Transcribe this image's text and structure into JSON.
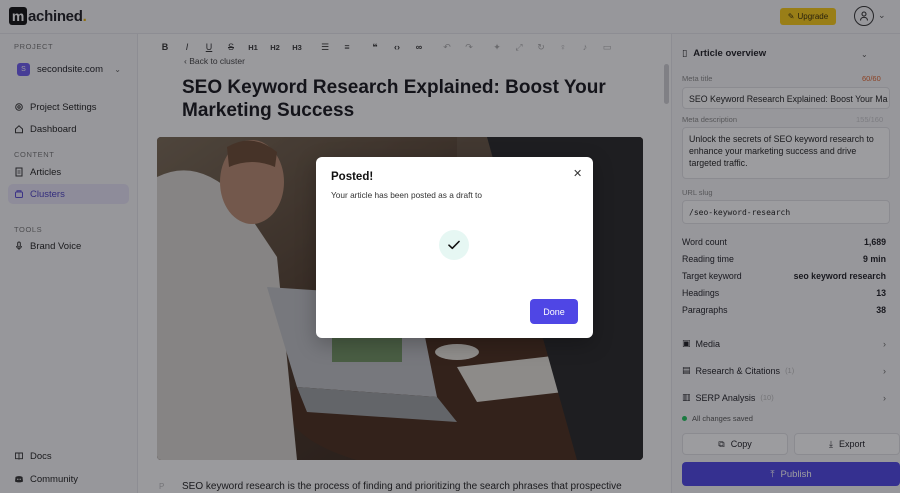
{
  "brand": {
    "prefix": "m",
    "rest": "achined",
    "dot": "."
  },
  "header": {
    "upgrade_label": "Upgrade"
  },
  "sidebar": {
    "project_label": "PROJECT",
    "project_initial": "S",
    "project_name": "secondsite.com",
    "items_top": [
      {
        "label": "Project Settings",
        "icon": "gear-icon"
      },
      {
        "label": "Dashboard",
        "icon": "home-icon"
      }
    ],
    "content_label": "CONTENT",
    "items_content": [
      {
        "label": "Articles",
        "icon": "article-icon"
      },
      {
        "label": "Clusters",
        "icon": "clusters-icon"
      }
    ],
    "tools_label": "TOOLS",
    "items_tools": [
      {
        "label": "Brand Voice",
        "icon": "microphone-icon"
      }
    ],
    "items_bottom": [
      {
        "label": "Docs",
        "icon": "book-icon"
      },
      {
        "label": "Community",
        "icon": "discord-icon"
      }
    ]
  },
  "editor": {
    "toolbar": [
      "B",
      "I",
      "U",
      "S",
      "H1",
      "H2",
      "H3"
    ],
    "back_label": "Back to cluster",
    "title": "SEO Keyword Research Explained: Boost Your Marketing Success",
    "body_start": "SEO keyword research is the process of finding and prioritizing the search phrases that prospective"
  },
  "overview": {
    "heading": "Article overview",
    "meta_title_label": "Meta title",
    "meta_title_count": "60/60",
    "meta_title": "SEO Keyword Research Explained: Boost Your Ma",
    "meta_desc_label": "Meta description",
    "meta_desc_count": "155/160",
    "meta_desc": [
      "Unlock the secrets of SEO keyword research to",
      "enhance your marketing success and drive",
      "targeted traffic."
    ],
    "slug_label": "URL slug",
    "slug": "/seo-keyword-research",
    "stats": [
      {
        "label": "Word count",
        "value": "1,689"
      },
      {
        "label": "Reading time",
        "value": "9 min"
      },
      {
        "label": "Target keyword",
        "value": "seo keyword research"
      },
      {
        "label": "Headings",
        "value": "13"
      },
      {
        "label": "Paragraphs",
        "value": "38"
      }
    ],
    "sections": [
      {
        "label": "Media",
        "badge": ""
      },
      {
        "label": "Research & Citations",
        "badge": "(1)"
      },
      {
        "label": "SERP Analysis",
        "badge": "(10)"
      }
    ],
    "saved": "All changes saved",
    "copy_label": "Copy",
    "export_label": "Export",
    "publish_label": "Publish"
  },
  "modal": {
    "title": "Posted!",
    "message": "Your article has been posted as a draft to",
    "done_label": "Done"
  },
  "colors": {
    "accent": "#4f46e5",
    "upgrade": "#facc15",
    "success": "#22c55e"
  }
}
